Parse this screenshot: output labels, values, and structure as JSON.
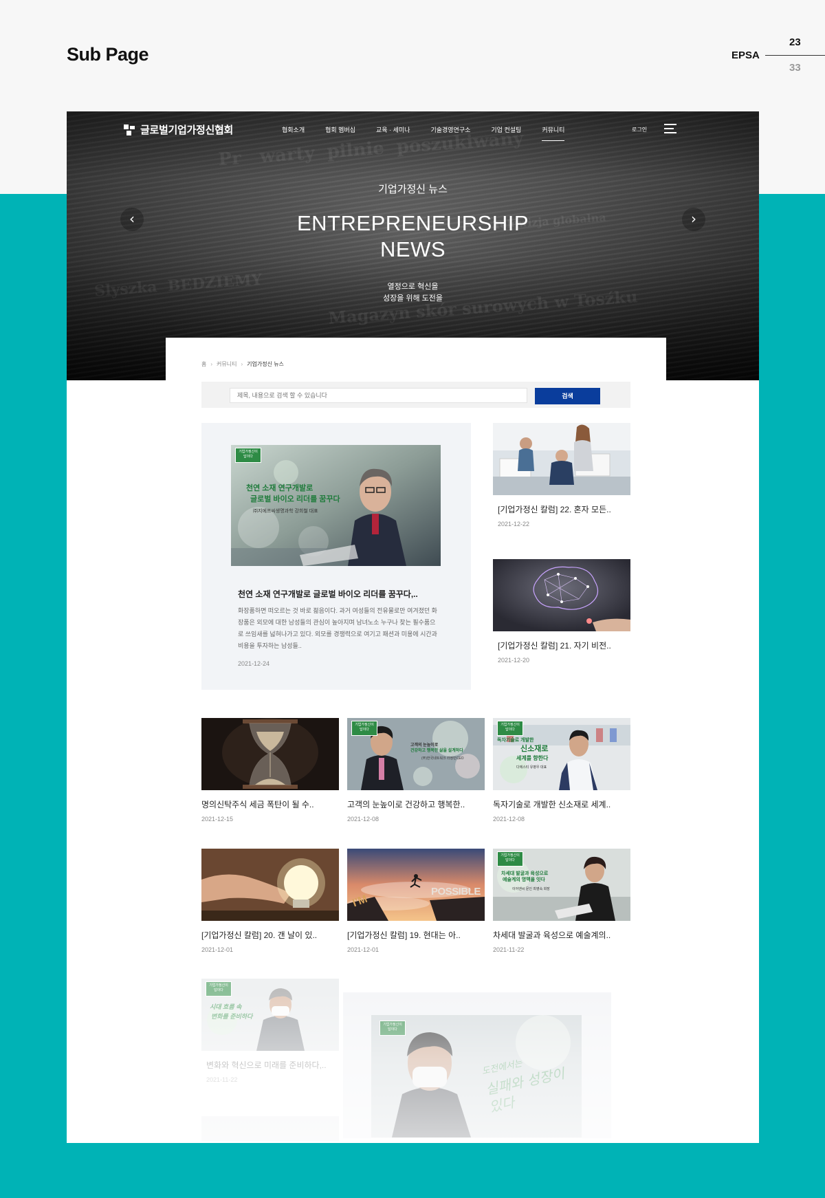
{
  "frame": {
    "page_label": "Sub Page",
    "brand": "EPSA",
    "current_page": "23",
    "total_pages": "33"
  },
  "header": {
    "logo_text": "글로벌기업가정신협회",
    "nav": [
      "협회소개",
      "협회 멤버십",
      "교육 · 세미나",
      "기술경영연구소",
      "기업 컨설팅",
      "커뮤니티"
    ],
    "active_nav": "커뮤니티",
    "login": "로그인"
  },
  "hero": {
    "kicker": "기업가정신 뉴스",
    "title_line1": "ENTREPRENEURSHIP",
    "title_line2": "NEWS",
    "subtitle_line1": "열정으로 혁신을",
    "subtitle_line2": "성장을 위해 도전을",
    "prev_icon": "chevron-left-icon",
    "next_icon": "chevron-right-icon"
  },
  "breadcrumb": {
    "home": "홈",
    "level1": "커뮤니티",
    "level2": "기업가정신 뉴스"
  },
  "search": {
    "placeholder": "제목, 내용으로 검색 할 수 있습니다",
    "button": "검색"
  },
  "featured": {
    "thumb_badge": "기업가정신이 답이다",
    "thumb_line1": "천연 소재 연구개발로",
    "thumb_line2": "글로벌 바이오 리더를 꿈꾸다",
    "thumb_caption": "㈜지에프씨생명과학 강희철 대표",
    "title": "천연 소재 연구개발로 글로벌 바이오 리더를 꿈꾸다,..",
    "excerpt": "화장품하면 떠오르는 것 바로 젊음이다. 과거 여성들의 전유물로만 여겨졌던 화장품은 외모에 대한 남성들의 관심이 높아지며 남녀노소 누구나 찾는 필수품으로 쓰임새를 넓혀나가고 있다. 외모를 경쟁력으로 여기고 패션과 미용에 시간과 비용을 투자하는 남성들..",
    "date": "2021-12-24"
  },
  "side_cards": [
    {
      "title": "[기업가정신 칼럼] 22. 혼자 모든..",
      "date": "2021-12-22"
    },
    {
      "title": "[기업가정신 칼럼] 21. 자기 비전..",
      "date": "2021-12-20"
    }
  ],
  "grid_cards": [
    {
      "title": "명의신탁주식 세금 폭탄이 될 수..",
      "date": "2021-12-15"
    },
    {
      "title": "고객의 눈높이로 건강하고 행복한..",
      "date": "2021-12-08"
    },
    {
      "title": "독자기술로 개발한 신소재로 세계..",
      "date": "2021-12-08"
    },
    {
      "title": "[기업가정신 칼럼] 20. 갠 날이 있..",
      "date": "2021-12-01"
    },
    {
      "title": "[기업가정신 칼럼] 19. 현대는 아..",
      "date": "2021-12-01"
    },
    {
      "title": "차세대 발굴과 육성으로 예술계의..",
      "date": "2021-11-22"
    },
    {
      "title": "변화와 혁신으로 미래를 준비하다,..",
      "date": "2021-11-22"
    }
  ],
  "thumb_texts": {
    "card2_line1": "고객의 눈높이로",
    "card2_line2": "건강하고 행복한 삶을 설계하다",
    "card2_caption": "(주)한국네트워크 라정민CEO",
    "card3_line1": "독자기술로 개발한",
    "card3_line2": "신소재로",
    "card3_line3": "세계를 향한다",
    "card3_caption": "다에스티 유병우 대표",
    "card5_word1": "I'M",
    "card5_word2": "POSSIBLE",
    "card6_line1": "차세대 발굴과 육성으로",
    "card6_line2": "예술계의 명맥을 잇다",
    "card6_caption": "이어엔씨 문인 최영숙 회장",
    "card7_line1": "시대 흐름 속",
    "card7_line2": "변화를 준비하다",
    "popup_line1": "도전에서는",
    "popup_line2": "실패와 성장이 있다"
  },
  "colors": {
    "accent_teal": "#00b3b6",
    "button_navy": "#0a3d9c"
  }
}
